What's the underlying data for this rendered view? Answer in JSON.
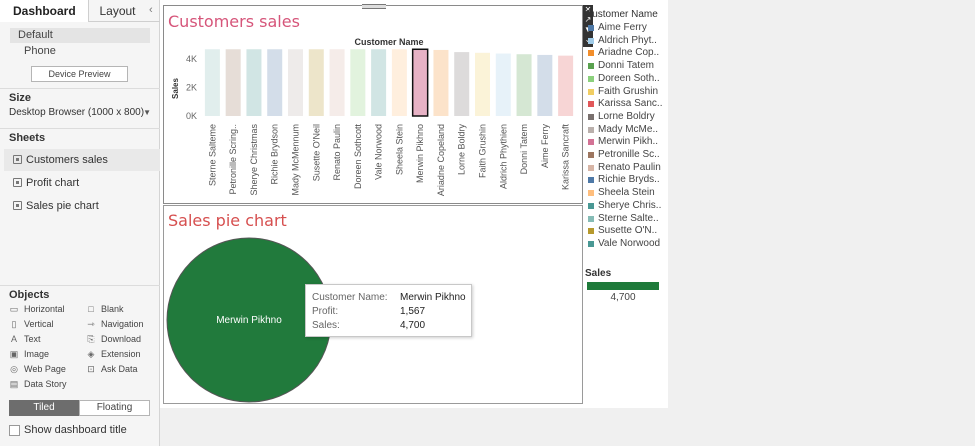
{
  "left_panel": {
    "tabs": {
      "dashboard": "Dashboard",
      "layout": "Layout"
    },
    "devices": {
      "default": "Default",
      "phone": "Phone",
      "preview_button": "Device Preview"
    },
    "size": {
      "title": "Size",
      "value": "Desktop Browser (1000 x 800)"
    },
    "sheets": {
      "title": "Sheets",
      "items": [
        "Customers sales",
        "Profit chart",
        "Sales pie chart"
      ]
    },
    "objects": {
      "title": "Objects",
      "items": [
        {
          "label": "Horizontal",
          "icon": "horizontal-icon"
        },
        {
          "label": "Blank",
          "icon": "blank-icon"
        },
        {
          "label": "Vertical",
          "icon": "vertical-icon"
        },
        {
          "label": "Navigation",
          "icon": "navigation-icon"
        },
        {
          "label": "Text",
          "icon": "text-icon"
        },
        {
          "label": "Download",
          "icon": "download-icon"
        },
        {
          "label": "Image",
          "icon": "image-icon"
        },
        {
          "label": "Extension",
          "icon": "extension-icon"
        },
        {
          "label": "Web Page",
          "icon": "web-page-icon"
        },
        {
          "label": "Ask Data",
          "icon": "ask-data-icon"
        },
        {
          "label": "Data Story",
          "icon": "data-story-icon"
        }
      ]
    },
    "layout_toggle": {
      "tiled": "Tiled",
      "floating": "Floating"
    },
    "show_title": "Show dashboard title"
  },
  "dashboard": {
    "sales_title": "Customers sales",
    "sales_title_color": "#d6557a",
    "pie_title": "Sales pie chart",
    "pie_title_color": "#d64f4f",
    "legend": {
      "title": "Customer Name",
      "items": [
        {
          "label": "Aime Ferry",
          "color": "#4e79a7"
        },
        {
          "label": "Aldrich Phyt..",
          "color": "#a0cbe8"
        },
        {
          "label": "Ariadne Cop..",
          "color": "#f28e2b"
        },
        {
          "label": "Donni Tatem",
          "color": "#59a14f"
        },
        {
          "label": "Doreen Soth..",
          "color": "#8cd17d"
        },
        {
          "label": "Faith Grushin",
          "color": "#f1ce63"
        },
        {
          "label": "Karissa Sanc..",
          "color": "#e15759"
        },
        {
          "label": "Lorne Boldry",
          "color": "#79706e"
        },
        {
          "label": "Mady McMe..",
          "color": "#bab0ac"
        },
        {
          "label": "Merwin Pikh..",
          "color": "#d37295"
        },
        {
          "label": "Petronille Sc..",
          "color": "#9d7660"
        },
        {
          "label": "Renato Paulin",
          "color": "#d7b5a6"
        },
        {
          "label": "Richie Bryds..",
          "color": "#4e79a7"
        },
        {
          "label": "Sheela Stein",
          "color": "#ffbe7d"
        },
        {
          "label": "Sherye Chris..",
          "color": "#499894"
        },
        {
          "label": "Sterne Salte..",
          "color": "#86bcb6"
        },
        {
          "label": "Susette O'N..",
          "color": "#b6992d"
        },
        {
          "label": "Vale Norwood",
          "color": "#499894"
        }
      ]
    },
    "sales_legend": {
      "title": "Sales",
      "value": "4,700",
      "color": "#1e7a3a"
    },
    "tooltip": {
      "customer_key": "Customer Name:",
      "customer_val": "Merwin Pikhno",
      "profit_key": "Profit:",
      "profit_val": "1,567",
      "sales_key": "Sales:",
      "sales_val": "4,700"
    },
    "pie_label": "Merwin Pikhno",
    "pie_color": "#217a3c"
  },
  "chart_data": [
    {
      "type": "bar",
      "title": "Customers sales",
      "xlabel": "Customer Name",
      "ylabel": "Sales",
      "ylim": [
        0,
        5000
      ],
      "yticks": [
        "0K",
        "2K",
        "4K"
      ],
      "categories": [
        "Sterne Salteme",
        "Petronille Scring..",
        "Sherye Christmas",
        "Richie Brydson",
        "Mady McMennum",
        "Susette O'Neil",
        "Renato Paulin",
        "Doreen Sothcott",
        "Vale Norwood",
        "Sheela Stein",
        "Merwin Pikhno",
        "Ariadne Copeland",
        "Lorne Boldry",
        "Faith Grushin",
        "Aldrich Phythien",
        "Donni Tatem",
        "Aime Ferry",
        "Karissa Sancraft"
      ],
      "values": [
        4700,
        4700,
        4700,
        4700,
        4700,
        4700,
        4700,
        4700,
        4700,
        4700,
        4700,
        4650,
        4500,
        4450,
        4400,
        4350,
        4300,
        4250
      ],
      "colors": [
        "#86bcb6",
        "#9d7660",
        "#499894",
        "#4e79a7",
        "#bab0ac",
        "#b6992d",
        "#d7b5a6",
        "#8cd17d",
        "#499894",
        "#ffbe7d",
        "#d37295",
        "#f28e2b",
        "#79706e",
        "#f1ce63",
        "#a0cbe8",
        "#59a14f",
        "#4e79a7",
        "#e15759"
      ],
      "selected": "Merwin Pikhno"
    },
    {
      "type": "pie",
      "title": "Sales pie chart",
      "categories": [
        "Merwin Pikhno"
      ],
      "values": [
        4700
      ]
    }
  ]
}
